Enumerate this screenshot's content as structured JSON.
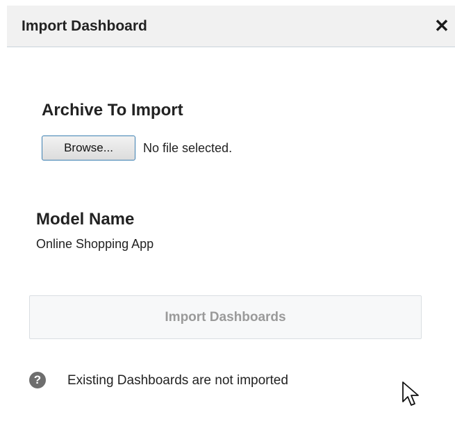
{
  "header": {
    "title": "Import Dashboard",
    "close_symbol": "✕"
  },
  "archive": {
    "heading": "Archive To Import",
    "browse_label": "Browse...",
    "file_status": "No file selected."
  },
  "model": {
    "heading": "Model Name",
    "value": "Online Shopping App"
  },
  "actions": {
    "import_label": "Import Dashboards"
  },
  "help": {
    "icon_glyph": "?",
    "text": "Existing Dashboards are not imported"
  },
  "icons": {
    "close": "close-icon",
    "help": "question-circle-icon",
    "cursor": "mouse-pointer-icon"
  },
  "colors": {
    "header_bg": "#f1f1f1",
    "button_border": "#3c7fb1",
    "disabled_text": "#9a9a9a",
    "help_icon": "#6e6e6e"
  }
}
